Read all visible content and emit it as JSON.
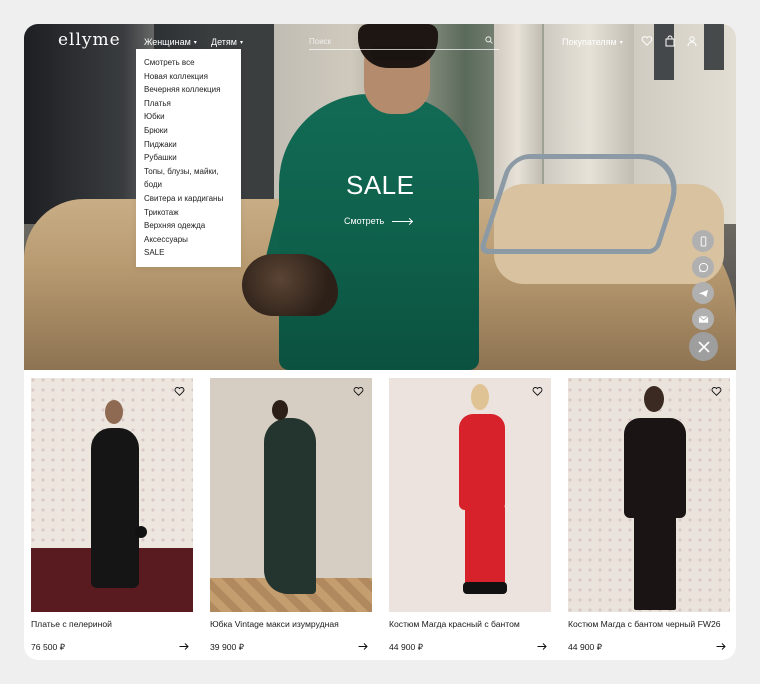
{
  "header": {
    "logo": "ellyme",
    "nav_women": "Женщинам",
    "nav_kids": "Детям",
    "search_placeholder": "Поиск",
    "nav_buyers": "Покупателям",
    "icons": [
      "heart-icon",
      "bag-icon",
      "user-icon",
      "search-icon"
    ]
  },
  "dropdown": {
    "items": [
      "Смотреть все",
      "Новая коллекция",
      "Вечерняя коллекция",
      "Платья",
      "Юбки",
      "Брюки",
      "Пиджаки",
      "Рубашки",
      "Топы, блузы, майки,",
      "боди",
      "Свитера и кардиганы",
      "Трикотаж",
      "Верхняя одежда",
      "Аксессуары",
      "SALE"
    ]
  },
  "hero": {
    "title": "SALE",
    "cta": "Смотреть"
  },
  "contacts": [
    "phone-icon",
    "whatsapp-icon",
    "telegram-icon",
    "email-icon",
    "close-icon"
  ],
  "products": [
    {
      "name": "Платье с пелериной",
      "price": "76 500 ₽"
    },
    {
      "name": "Юбка Vintage макси изумрудная",
      "price": "39 900 ₽"
    },
    {
      "name": "Костюм Магда красный с бантом",
      "price": "44 900 ₽"
    },
    {
      "name": "Костюм Магда с бантом черный FW26",
      "price": "44 900 ₽"
    }
  ],
  "colors": {
    "hero_dress": "#0e5f4a",
    "product_red": "#d8222b",
    "fab": "#b0b0b0"
  }
}
